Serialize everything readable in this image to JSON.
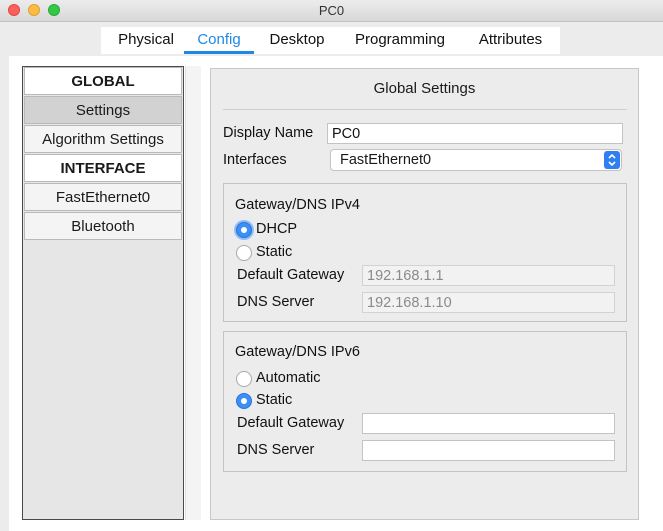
{
  "window": {
    "title": "PC0"
  },
  "tabs": [
    {
      "label": "Physical"
    },
    {
      "label": "Config"
    },
    {
      "label": "Desktop"
    },
    {
      "label": "Programming"
    },
    {
      "label": "Attributes"
    }
  ],
  "active_tab": "Config",
  "sidebar": {
    "items": [
      {
        "label": "GLOBAL",
        "kind": "header"
      },
      {
        "label": "Settings",
        "kind": "item",
        "selected": true
      },
      {
        "label": "Algorithm Settings",
        "kind": "item"
      },
      {
        "label": "INTERFACE",
        "kind": "header"
      },
      {
        "label": "FastEthernet0",
        "kind": "item"
      },
      {
        "label": "Bluetooth",
        "kind": "item"
      }
    ]
  },
  "settings": {
    "title": "Global Settings",
    "display_name_label": "Display Name",
    "display_name_value": "PC0",
    "interfaces_label": "Interfaces",
    "interfaces_value": "FastEthernet0"
  },
  "ipv4": {
    "title": "Gateway/DNS IPv4",
    "option_dhcp": "DHCP",
    "option_static": "Static",
    "selected": "DHCP",
    "gateway_label": "Default Gateway",
    "gateway_value": "192.168.1.1",
    "dns_label": "DNS Server",
    "dns_value": "192.168.1.10"
  },
  "ipv6": {
    "title": "Gateway/DNS IPv6",
    "option_automatic": "Automatic",
    "option_static": "Static",
    "selected": "Static",
    "gateway_label": "Default Gateway",
    "gateway_value": "",
    "dns_label": "DNS Server",
    "dns_value": ""
  },
  "colors": {
    "accent": "#1e88e5",
    "radio_checked": "#3b8ff5",
    "select_arrow": "#2f7ff2"
  }
}
